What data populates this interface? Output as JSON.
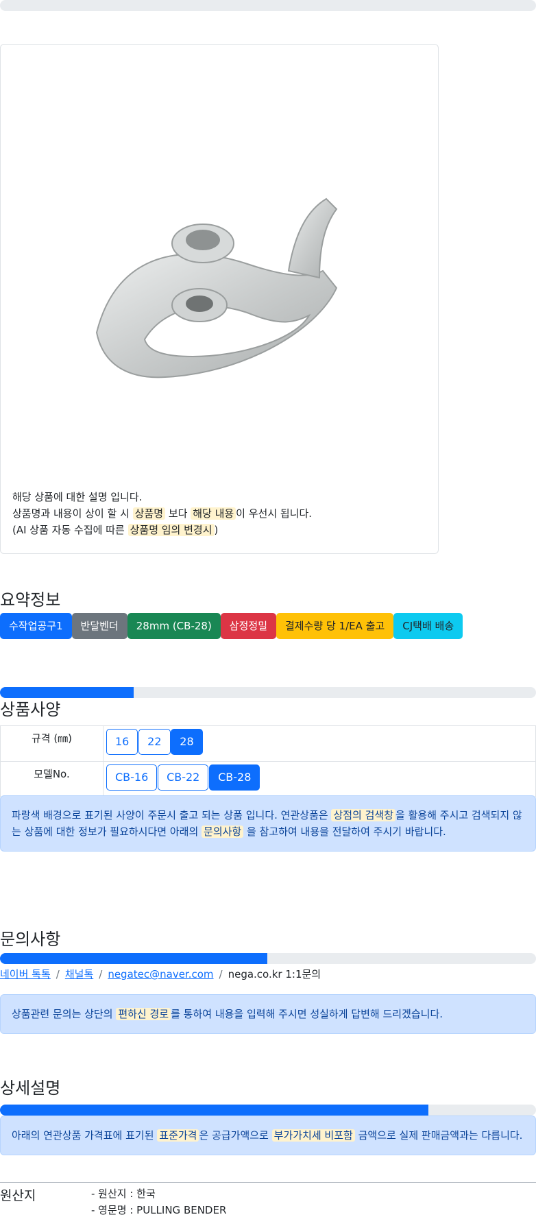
{
  "card": {
    "line1": "해당 상품에 대한 설명 입니다.",
    "line2_pre": "상품명과 내용이 상이 할 시 ",
    "line2_hl1": "상품명",
    "line2_mid": " 보다 ",
    "line2_hl2": "해당 내용",
    "line2_post": "이 우선시 됩니다.",
    "line3_pre": "(AI 상품 자동 수집에 따른 ",
    "line3_hl": "상품명 임의 변경시",
    "line3_post": ")"
  },
  "summary": {
    "title": "요약정보",
    "badges": [
      {
        "label": "수작업공구1",
        "color": "#0d6efd"
      },
      {
        "label": "반달벤더",
        "color": "#6c757d"
      },
      {
        "label": "28mm (CB-28)",
        "color": "#198754"
      },
      {
        "label": "삼정정밀",
        "color": "#dc3545"
      },
      {
        "label": "결제수량 당 1/EA 출고",
        "color": "#ffc107"
      },
      {
        "label": "CJ택배 배송",
        "color": "#0dcaf0"
      }
    ]
  },
  "spec": {
    "title": "상품사양",
    "progress": 0.25,
    "rows": [
      {
        "label": "규격 (㎜)",
        "options": [
          "16",
          "22",
          "28"
        ],
        "selected": "28"
      },
      {
        "label": "모델No.",
        "options": [
          "CB-16",
          "CB-22",
          "CB-28"
        ],
        "selected": "CB-28"
      }
    ],
    "notice_pre": "파랑색 배경으로 표기된 사양이 주문시 출고 되는 상품 입니다. 연관상품은 ",
    "notice_hl1": "상점의 검색창",
    "notice_mid": "을 활용해 주시고 검색되지 않는 상품에 대한 정보가 필요하시다면 아래의 ",
    "notice_hl2": "문의사항",
    "notice_post": " 을 참고하여 내용을 전달하여 주시기 바랍니다."
  },
  "inquiry": {
    "title": "문의사항",
    "progress": 0.5,
    "links": [
      "네이버 톡톡",
      "채널톡",
      "negatec@naver.com"
    ],
    "plain": "nega.co.kr 1:1문의",
    "separator": "/",
    "notice_pre": "상품관련 문의는 상단의 ",
    "notice_hl": "편하신 경로",
    "notice_post": "를 통하여 내용을 입력해 주시면 성실하게 답변해 드리겠습니다."
  },
  "detail": {
    "title": "상세설명",
    "progress": 0.8,
    "notice_pre": "아래의 연관상품 가격표에 표기된 ",
    "notice_hl1": "표준가격",
    "notice_mid": "은 공급가액으로 ",
    "notice_hl2": "부가가치세 비포함",
    "notice_post": " 금액으로 실제 판매금액과는 다릅니다."
  },
  "origin": {
    "label": "원산지",
    "items": [
      "- 원산지 : 한국",
      "- 영문명 : PULLING BENDER"
    ]
  }
}
